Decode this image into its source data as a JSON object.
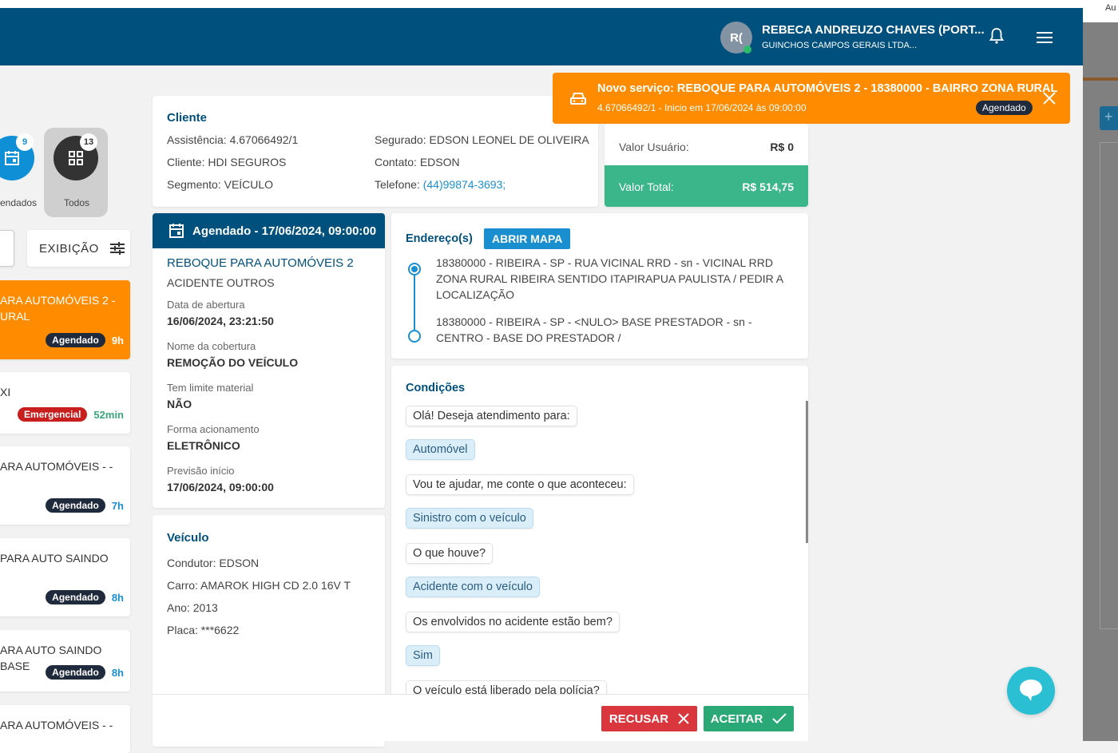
{
  "header": {
    "avatar_initials": "R(",
    "user_name": "REBECA ANDREUZO CHAVES (PORT...",
    "company": "GUINCHOS CAMPOS GERAIS LTDA...",
    "icons": [
      "bell-icon",
      "menu-icon"
    ]
  },
  "right_panel": {
    "label": "Au"
  },
  "toast": {
    "title": "Novo serviço: REBOQUE PARA AUTOMÓVEIS 2 - 18380000 - BAIRRO ZONA RURAL",
    "subtitle": "4.67066492/1 - Inicio em 17/06/2024 às 09:00:00",
    "badge": "Agendado",
    "color": "#ff8c00"
  },
  "filters": [
    {
      "label": "endados",
      "count": "9",
      "color": "#0f8fd6"
    },
    {
      "label": "Todos",
      "count": "13",
      "color": "#333333"
    }
  ],
  "exibicao_label": "EXIBIÇÃO",
  "list": [
    {
      "text": "ARA AUTOMÓVEIS 2 - URAL",
      "badge": "Agendado",
      "time": "9h",
      "active": true
    },
    {
      "text": "XI",
      "badge": "Emergencial",
      "time": "52min"
    },
    {
      "text": "ARA AUTOMÓVEIS - -",
      "badge": "Agendado",
      "time": "7h"
    },
    {
      "text": " PARA AUTO SAINDO",
      "badge": "Agendado",
      "time": "8h"
    },
    {
      "text": "ARA AUTO SAINDO BASE",
      "badge": "Agendado",
      "time": "8h"
    },
    {
      "text": "ARA AUTOMÓVEIS - -"
    }
  ],
  "cliente": {
    "title": "Cliente",
    "assistencia": "Assistência: 4.67066492/1",
    "cliente": "Cliente: HDI SEGUROS",
    "segmento": "Segmento: VEÍCULO",
    "segurado": "Segurado: EDSON LEONEL DE OLIVEIRA",
    "contato": "Contato: EDSON",
    "telefone_label": "Telefone: ",
    "telefone": "(44)99874-3693;"
  },
  "valores": {
    "usuario_label": "Valor Usuário:",
    "usuario": "R$ 0",
    "total_label": "Valor Total:",
    "total": "R$ 514,75"
  },
  "servico": {
    "header": "Agendado - 17/06/2024, 09:00:00",
    "name": "REBOQUE PARA AUTOMÓVEIS 2",
    "type": "ACIDENTE OUTROS",
    "fields": [
      {
        "label": "Data de abertura",
        "value": "16/06/2024, 23:21:50"
      },
      {
        "label": "Nome da cobertura",
        "value": "REMOÇÃO DO VEÍCULO"
      },
      {
        "label": "Tem limite material",
        "value": "NÃO"
      },
      {
        "label": "Forma acionamento",
        "value": "ELETRÔNICO"
      },
      {
        "label": "Previsão início",
        "value": "17/06/2024, 09:00:00"
      }
    ]
  },
  "veiculo": {
    "title": "Veículo",
    "condutor": "Condutor: EDSON",
    "carro": "Carro: AMAROK HIGH CD 2.0 16V T",
    "ano": "Ano: 2013",
    "placa": "Placa: ***6622"
  },
  "endereco": {
    "title": "Endereço(s)",
    "map_button": "ABRIR MAPA",
    "origin": "18380000 - RIBEIRA - SP - RUA VICINAL RRD - sn - VICINAL RRD ZONA RURAL RIBEIRA SENTIDO ITAPIRAPUA PAULISTA / PEDIR A LOCALIZAÇÃO",
    "destination": "18380000 - RIBEIRA - SP - <NULO> BASE PRESTADOR - sn - CENTRO - BASE DO PRESTADOR /"
  },
  "condicoes": {
    "title": "Condições",
    "messages": [
      {
        "text": "Olá! Deseja atendimento para:",
        "answer": false
      },
      {
        "text": "Automóvel",
        "answer": true
      },
      {
        "text": "Vou te ajudar, me conte o que aconteceu:",
        "answer": false
      },
      {
        "text": "Sinistro com o veículo",
        "answer": true
      },
      {
        "text": "O que houve?",
        "answer": false
      },
      {
        "text": "Acidente com o veículo",
        "answer": true
      },
      {
        "text": "Os envolvidos no acidente estão bem?",
        "answer": false
      },
      {
        "text": "Sim",
        "answer": true
      },
      {
        "text": "O veículo está liberado pela polícia?",
        "answer": false
      }
    ]
  },
  "actions": {
    "recusar": "RECUSAR",
    "aceitar": "ACEITAR"
  }
}
